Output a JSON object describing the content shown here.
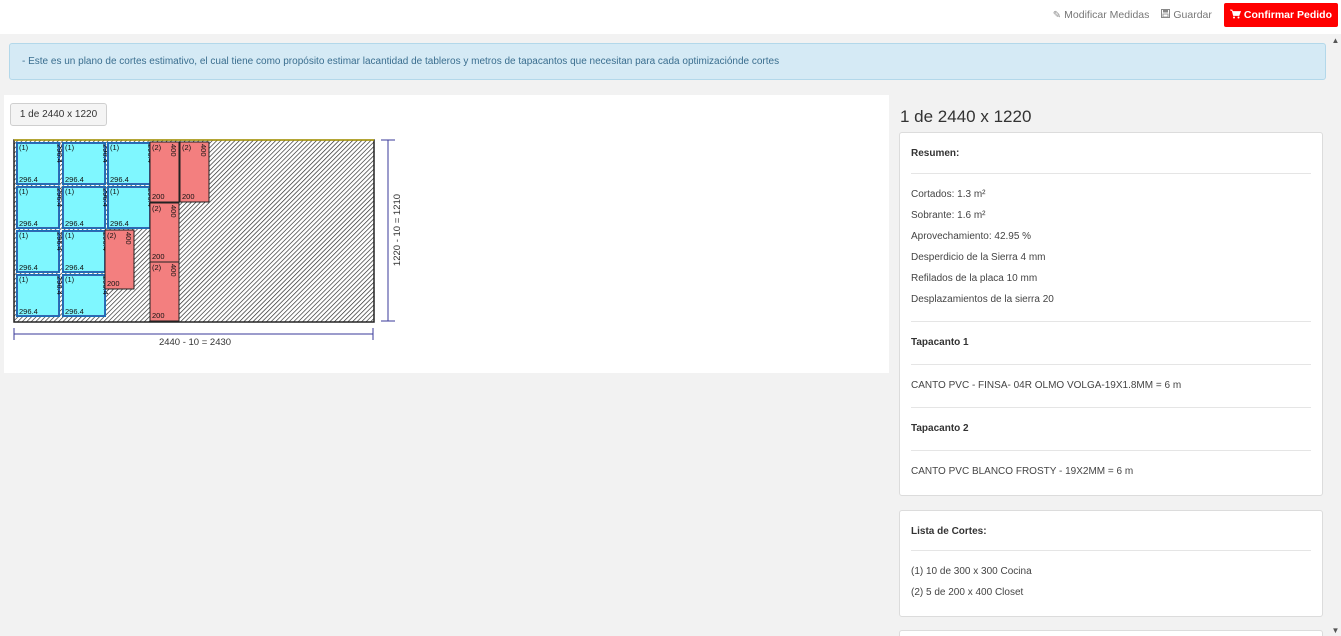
{
  "toolbar": {
    "modify_label": "Modificar Medidas",
    "save_label": "Guardar",
    "confirm_label": "Confirmar Pedido",
    "confirm_color": "#ff0000"
  },
  "alert": {
    "text": "- Este es un plano de cortes estimativo, el cual tiene como propósito estimar lacantidad de tableros y metros de tapacantos que necesitan para cada optimizaciónde cortes"
  },
  "plan": {
    "sheet_button": "1 de 2440 x 1220",
    "width_dim": "2440 - 10 = 2430",
    "height_dim": "1220 - 10 = 1210",
    "piece_colors": {
      "piece1": "#7ff7ff",
      "piece2": "#f37f7f"
    },
    "pieces1": [
      {
        "tag": "(1)",
        "w": "296.4",
        "h": "296.4"
      },
      {
        "tag": "(1)",
        "w": "296.4",
        "h": "296.4"
      },
      {
        "tag": "(1)",
        "w": "296.4",
        "h": "296.4"
      },
      {
        "tag": "(1)",
        "w": "296.4",
        "h": "296.4"
      },
      {
        "tag": "(1)",
        "w": "296.4",
        "h": "296.4"
      },
      {
        "tag": "(1)",
        "w": "296.4",
        "h": "296.4"
      },
      {
        "tag": "(1)",
        "w": "296.4",
        "h": "296.4"
      },
      {
        "tag": "(1)",
        "w": "296.4",
        "h": "296.4"
      },
      {
        "tag": "(1)",
        "w": "296.4",
        "h": "296.4"
      },
      {
        "tag": "(1)",
        "w": "296.4",
        "h": "296.4"
      }
    ],
    "pieces2": [
      {
        "tag": "(2)",
        "w": "200",
        "h": "400"
      },
      {
        "tag": "(2)",
        "w": "200",
        "h": "400"
      },
      {
        "tag": "(2)",
        "w": "200",
        "h": "400"
      },
      {
        "tag": "(2)",
        "w": "200",
        "h": "400"
      },
      {
        "tag": "(2)",
        "w": "200",
        "h": "400"
      }
    ]
  },
  "side": {
    "title": "1 de 2440 x 1220",
    "summary_title": "Resumen:",
    "cortados": "Cortados: 1.3 m²",
    "sobrante": "Sobrante: 1.6 m²",
    "aprovechamiento": "Aprovechamiento: 42.95 %",
    "desperdicio": "Desperdicio de la Sierra 4 mm",
    "refilados": "Refilados de la placa 10 mm",
    "desplazamientos": "Desplazamientos de la sierra 20",
    "tapacanto1_title": "Tapacanto 1",
    "tapacanto1_value": "CANTO PVC - FINSA- 04R OLMO VOLGA-19X1.8MM = 6 m",
    "tapacanto2_title": "Tapacanto 2",
    "tapacanto2_value": "CANTO PVC BLANCO FROSTY - 19X2MM = 6 m",
    "list_title": "Lista de Cortes:",
    "list_items": [
      "(1) 10 de 300 x 300 Cocina",
      "(2) 5 de 200 x 400 Closet"
    ]
  }
}
